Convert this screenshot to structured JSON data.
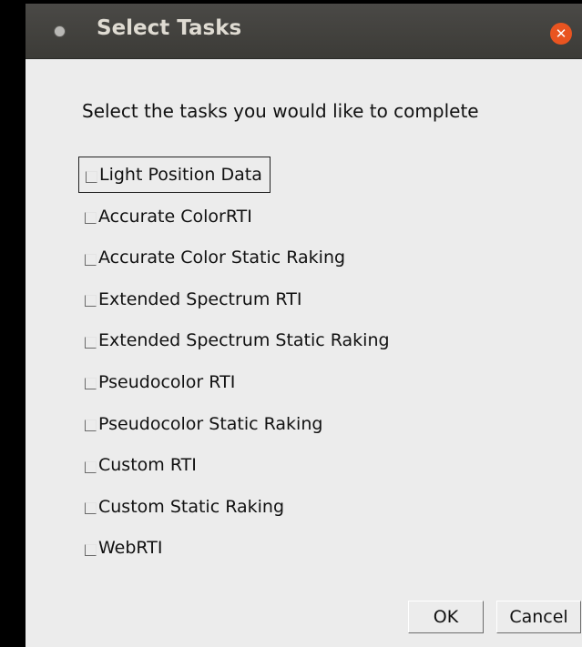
{
  "window": {
    "title": "Select Tasks",
    "close_icon": "✕"
  },
  "prompt": "Select the tasks you would like to complete",
  "tasks": [
    {
      "label": "Light Position Data",
      "checked": false,
      "focused": true
    },
    {
      "label": "Accurate ColorRTI",
      "checked": false,
      "focused": false
    },
    {
      "label": "Accurate Color Static Raking",
      "checked": false,
      "focused": false
    },
    {
      "label": "Extended Spectrum RTI",
      "checked": false,
      "focused": false
    },
    {
      "label": "Extended Spectrum Static Raking",
      "checked": false,
      "focused": false
    },
    {
      "label": "Pseudocolor RTI",
      "checked": false,
      "focused": false
    },
    {
      "label": "Pseudocolor Static Raking",
      "checked": false,
      "focused": false
    },
    {
      "label": "Custom RTI",
      "checked": false,
      "focused": false
    },
    {
      "label": "Custom Static Raking",
      "checked": false,
      "focused": false
    },
    {
      "label": "WebRTI",
      "checked": false,
      "focused": false
    }
  ],
  "buttons": {
    "ok_label": "OK",
    "cancel_label": "Cancel"
  },
  "colors": {
    "titlebar": "#3c3b37",
    "title_text": "#dfdbd2",
    "close_button": "#e95420",
    "dialog_background": "#ececec"
  }
}
